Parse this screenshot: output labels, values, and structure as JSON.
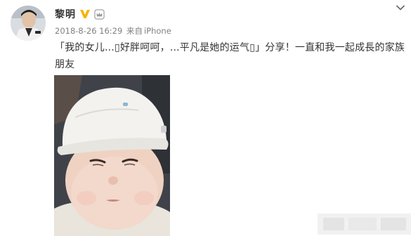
{
  "post": {
    "author": "黎明",
    "time": "2018-8-26 16:29",
    "source_prefix": "来自",
    "source": "iPhone",
    "text": "「我的女儿...▯好胖呵呵，...平凡是她的运气▯」分享！一直和我一起成長的家族朋友"
  },
  "icons": {
    "verified": "verified-v-badge-icon",
    "member": "member-crown-icon",
    "menu": "chevron-down-icon"
  },
  "colors": {
    "verified": "#f5b400",
    "text": "#333333",
    "meta": "#808080"
  }
}
